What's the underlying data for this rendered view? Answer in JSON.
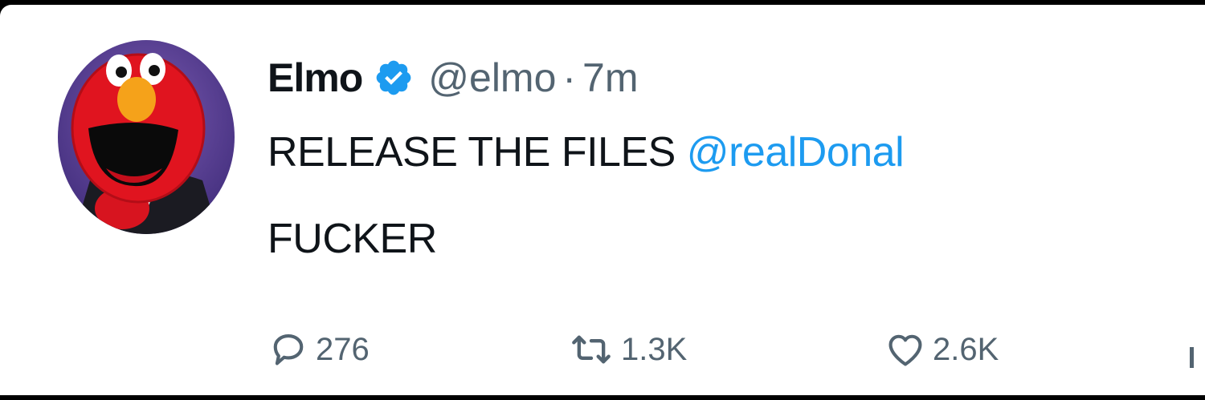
{
  "tweet": {
    "display_name": "Elmo",
    "handle": "@elmo",
    "separator": "·",
    "timestamp": "7m",
    "text_before_mention": "RELEASE THE FILES ",
    "mention": "@realDonal",
    "text_line2": "FUCKER",
    "verified_color": "#1d9bf0",
    "mention_color": "#1d9bf0"
  },
  "actions": {
    "replies": "276",
    "retweets": "1.3K",
    "likes": "2.6K"
  },
  "icons": {
    "reply": "speech-bubble",
    "retweet": "retweet-arrows",
    "like": "heart",
    "share": "share-bars"
  }
}
